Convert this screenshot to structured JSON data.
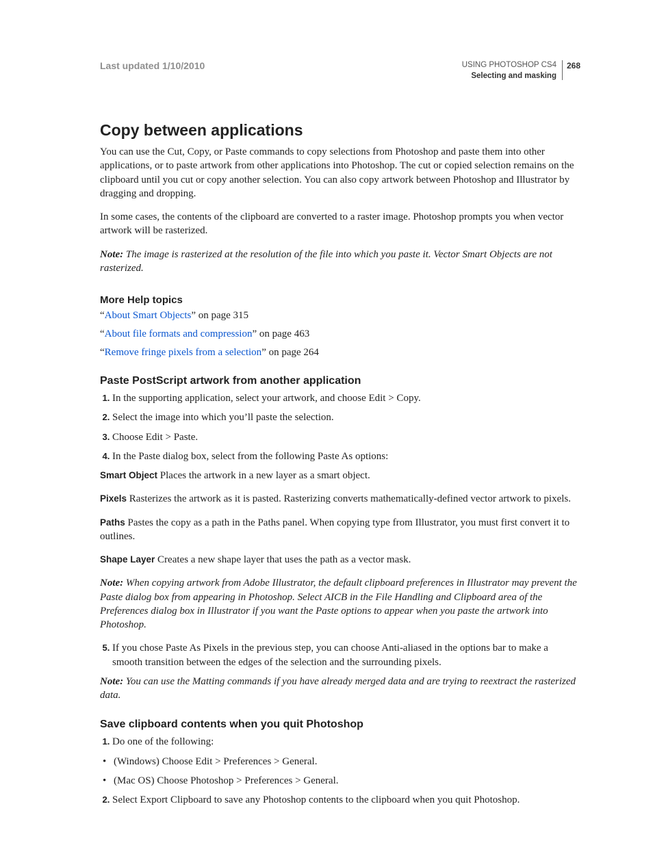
{
  "header": {
    "last_updated": "Last updated 1/10/2010",
    "product": "USING PHOTOSHOP CS4",
    "section": "Selecting and masking",
    "page_number": "268"
  },
  "main_heading": "Copy between applications",
  "intro_p1": "You can use the Cut, Copy, or Paste commands to copy selections from Photoshop and paste them into other applications, or to paste artwork from other applications into Photoshop. The cut or copied selection remains on the clipboard until you cut or copy another selection. You can also copy artwork between Photoshop and Illustrator by dragging and dropping.",
  "intro_p2": "In some cases, the contents of the clipboard are converted to a raster image. Photoshop prompts you when vector artwork will be rasterized.",
  "note_label": "Note:",
  "note1": " The image is rasterized at the resolution of the file into which you paste it. Vector Smart Objects are not rasterized.",
  "more_help_heading": "More Help topics",
  "refs": [
    {
      "pre": "“",
      "link": "About Smart Objects",
      "post": "” on page 315"
    },
    {
      "pre": "“",
      "link": "About file formats and compression",
      "post": "” on page 463"
    },
    {
      "pre": "“",
      "link": "Remove fringe pixels from a selection",
      "post": "” on page 264"
    }
  ],
  "subsection1_heading": "Paste PostScript artwork from another application",
  "steps1": [
    "In the supporting application, select your artwork, and choose Edit > Copy.",
    "Select the image into which you’ll paste the selection.",
    "Choose Edit > Paste.",
    "In the Paste dialog box, select from the following Paste As options:"
  ],
  "defs": [
    {
      "term": "Smart Object",
      "text": "  Places the artwork in a new layer as a smart object."
    },
    {
      "term": "Pixels",
      "text": "  Rasterizes the artwork as it is pasted. Rasterizing converts mathematically-defined vector artwork to pixels."
    },
    {
      "term": "Paths",
      "text": "  Pastes the copy as a path in the Paths panel. When copying type from Illustrator, you must first convert it to outlines."
    },
    {
      "term": "Shape Layer",
      "text": "  Creates a new shape layer that uses the path as a vector mask."
    }
  ],
  "note2": " When copying artwork from Adobe Illustrator, the default clipboard preferences in Illustrator may prevent the Paste dialog box from appearing in Photoshop. Select AICB in the File Handling and Clipboard area of the Preferences dialog box in Illustrator if you want the Paste options to appear when you paste the artwork into Photoshop.",
  "step5": "If you chose Paste As Pixels in the previous step, you can choose Anti-aliased in the options bar to make a smooth transition between the edges of the selection and the surrounding pixels.",
  "note3": " You can use the Matting commands if you have already merged data and are trying to reextract the rasterized data.",
  "subsection2_heading": "Save clipboard contents when you quit Photoshop",
  "steps2_first": "Do one of the following:",
  "bullets2": [
    "(Windows) Choose Edit > Preferences > General.",
    "(Mac OS) Choose Photoshop > Preferences > General."
  ],
  "steps2_second": "Select Export Clipboard to save any Photoshop contents to the clipboard when you quit Photoshop."
}
